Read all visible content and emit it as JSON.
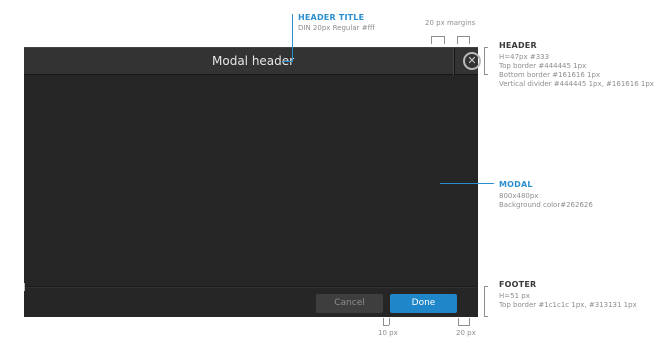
{
  "modal": {
    "header_title": "Modal header",
    "close_glyph": "✕",
    "close_icon": "close-circle-icon",
    "cancel_label": "Cancel",
    "done_label": "Done"
  },
  "annotations": {
    "header_title": {
      "title": "HEADER TITLE",
      "spec": "DIN 20px Regular #fff"
    },
    "margins": {
      "label": "20 px margins"
    },
    "header": {
      "title": "HEADER",
      "specs": [
        "H=47px #333",
        "Top border #444445 1px",
        "Bottom border #161616 1px",
        "Vertical divider #444445 1px, #161616 1px"
      ]
    },
    "modal": {
      "title": "MODAL",
      "specs": [
        "800x480px",
        "Background color#262626"
      ]
    },
    "footer": {
      "title": "FOOTER",
      "specs": [
        "H=51 px",
        "Top border #1c1c1c 1px, #313131 1px"
      ]
    },
    "bottom_left": "10 px",
    "bottom_right": "20 px"
  },
  "colors": {
    "accent": "#2a8fd0",
    "header_bg": "#333333",
    "modal_bg": "#262626",
    "done_bg": "#1e86c9"
  }
}
